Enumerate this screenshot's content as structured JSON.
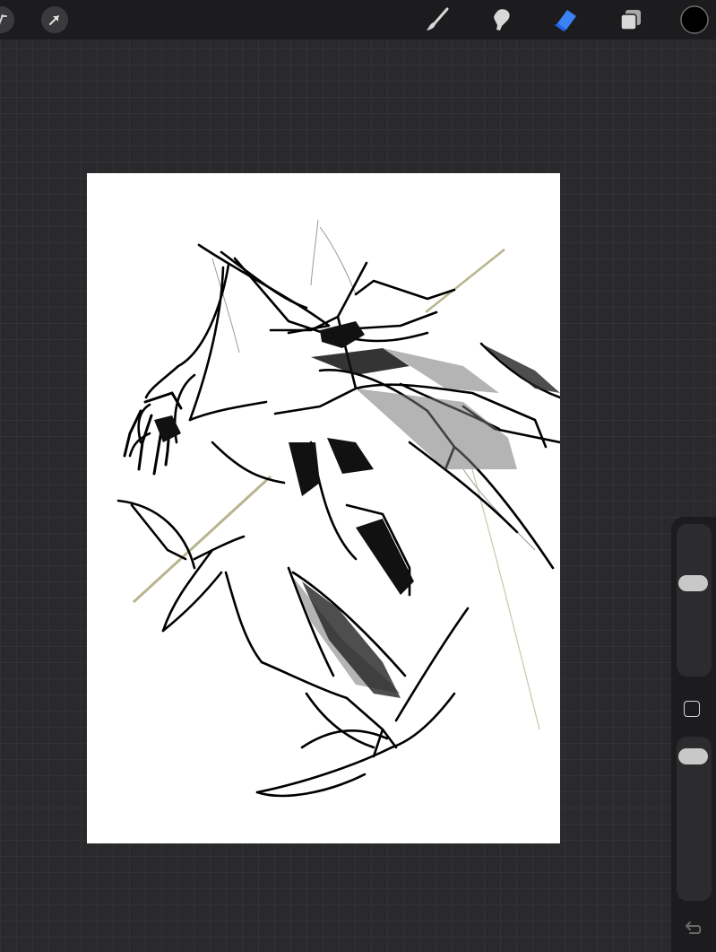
{
  "app": "Procreate",
  "colors": {
    "toolbar_bg": "#1c1c1e",
    "workspace_bg": "#2a2a2c",
    "active_tool": "#3b82f6",
    "current_color": "#000000",
    "guide_line": "#b8b48e"
  },
  "toolbar": {
    "left_icons": [
      "adjustments-icon",
      "selection-arrow-icon"
    ],
    "tools": [
      "brush-icon",
      "smudge-icon",
      "eraser-icon",
      "layers-icon"
    ],
    "active_tool": "eraser"
  },
  "sidebar": {
    "brush_size_level": 0.38,
    "opacity_level": 0.07,
    "icons": [
      "modify-square-icon",
      "undo-icon"
    ]
  }
}
